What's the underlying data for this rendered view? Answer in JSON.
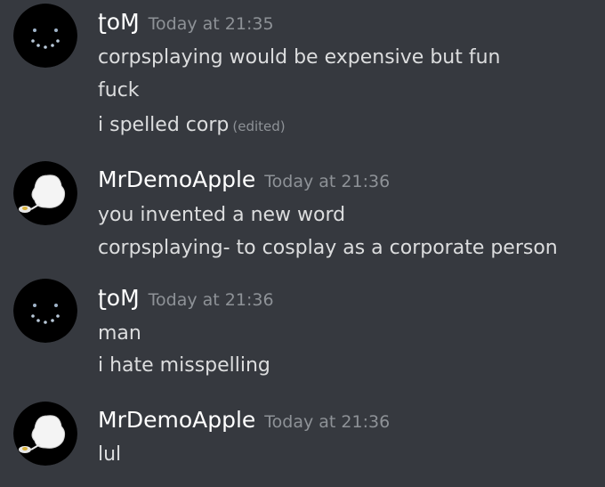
{
  "messages": [
    {
      "author": "ʈoⱮ",
      "time": "Today at 21:35",
      "lines": [
        "corpsplaying would be expensive but fun",
        "fuck",
        "i spelled corp"
      ],
      "edited": "(edited)"
    },
    {
      "author": "MrDemoApple",
      "time": "Today at 21:36",
      "lines": [
        "you invented a new word",
        "corpsplaying- to cosplay as a corporate person"
      ]
    },
    {
      "author": "ʈoⱮ",
      "time": "Today at 21:36",
      "lines": [
        "man",
        "i hate misspelling"
      ]
    },
    {
      "author": "MrDemoApple",
      "time": "Today at 21:36",
      "lines": [
        "lul"
      ]
    }
  ]
}
